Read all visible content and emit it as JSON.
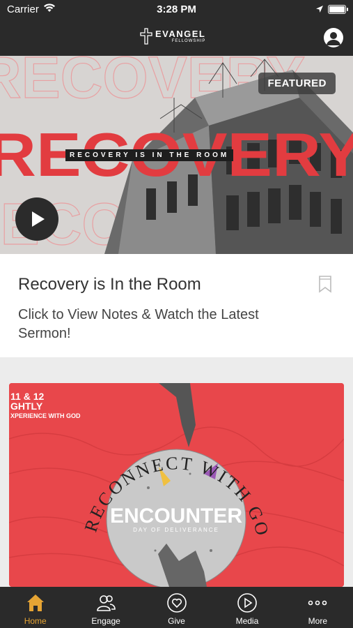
{
  "status_bar": {
    "carrier": "Carrier",
    "time": "3:28 PM"
  },
  "header": {
    "logo_name": "EVANGEL",
    "logo_sub": "FELLOWSHIP"
  },
  "featured": {
    "badge": "FEATURED",
    "big_word": "RECOVERY",
    "strap_text": "RECOVERY IS IN THE ROOM",
    "title": "Recovery is In the Room",
    "description": "Click to View Notes & Watch the Latest Sermon!"
  },
  "promo": {
    "dates_line1": "11 & 12",
    "dates_line2": "GHTLY",
    "dates_line3": "XPERIENCE WITH GOD",
    "circle_text": "RECONNECT WITH GOD",
    "encounter_title": "ENCOUNTER",
    "encounter_sub": "DAY OF DELIVERANCE"
  },
  "tabs": [
    {
      "label": "Home",
      "icon": "home-icon",
      "active": true
    },
    {
      "label": "Engage",
      "icon": "people-icon",
      "active": false
    },
    {
      "label": "Give",
      "icon": "heart-icon",
      "active": false
    },
    {
      "label": "Media",
      "icon": "play-circle-icon",
      "active": false
    },
    {
      "label": "More",
      "icon": "more-dots-icon",
      "active": false
    }
  ],
  "colors": {
    "accent": "#e6a434",
    "bar": "#2a2a2a",
    "promo_red": "#e8474b",
    "hero_red": "#e23c40"
  }
}
